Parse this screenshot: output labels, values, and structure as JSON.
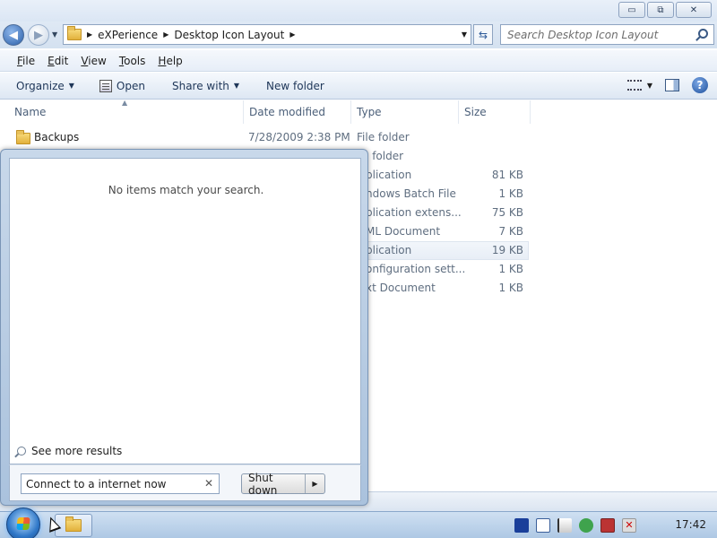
{
  "window": {
    "controls": {
      "minimize": "▭",
      "maximize": "⧉",
      "close": "✕"
    }
  },
  "address": {
    "crumbs": [
      "eXPerience",
      "Desktop Icon Layout"
    ],
    "separator": "▶",
    "search_placeholder": "Search Desktop Icon Layout"
  },
  "menu": [
    {
      "key": "F",
      "rest": "ile"
    },
    {
      "key": "E",
      "rest": "dit"
    },
    {
      "key": "V",
      "rest": "iew"
    },
    {
      "key": "T",
      "rest": "ools"
    },
    {
      "key": "H",
      "rest": "elp"
    }
  ],
  "toolbar": {
    "organize": "Organize",
    "open": "Open",
    "share_with": "Share with",
    "new_folder": "New folder",
    "help": "?"
  },
  "columns": {
    "name": "Name",
    "date_modified": "Date modified",
    "type": "Type",
    "size": "Size"
  },
  "files": [
    {
      "name": "Backups",
      "date": "7/28/2009 2:38 PM",
      "type": "File folder",
      "size": ""
    },
    {
      "name": "",
      "date": "",
      "type": "e folder",
      "size": ""
    },
    {
      "name": "",
      "date": "",
      "type": "plication",
      "size": "81 KB"
    },
    {
      "name": "",
      "date": "",
      "type": "ndows Batch File",
      "size": "1 KB"
    },
    {
      "name": "",
      "date": "",
      "type": "plication extens...",
      "size": "75 KB"
    },
    {
      "name": "",
      "date": "",
      "type": "ML Document",
      "size": "7 KB"
    },
    {
      "name": "",
      "date": "",
      "type": "plication",
      "size": "19 KB"
    },
    {
      "name": "",
      "date": "",
      "type": "onfiguration sett...",
      "size": "1 KB"
    },
    {
      "name": "",
      "date": "",
      "type": "xt Document",
      "size": "1 KB"
    }
  ],
  "start_menu": {
    "no_items": "No items match your search.",
    "see_more": "See more results",
    "search_value": "Connect to a internet now",
    "clear": "✕",
    "shutdown": "Shut down",
    "shutdown_arrow": "▶"
  },
  "taskbar": {
    "clock": "17:42"
  }
}
